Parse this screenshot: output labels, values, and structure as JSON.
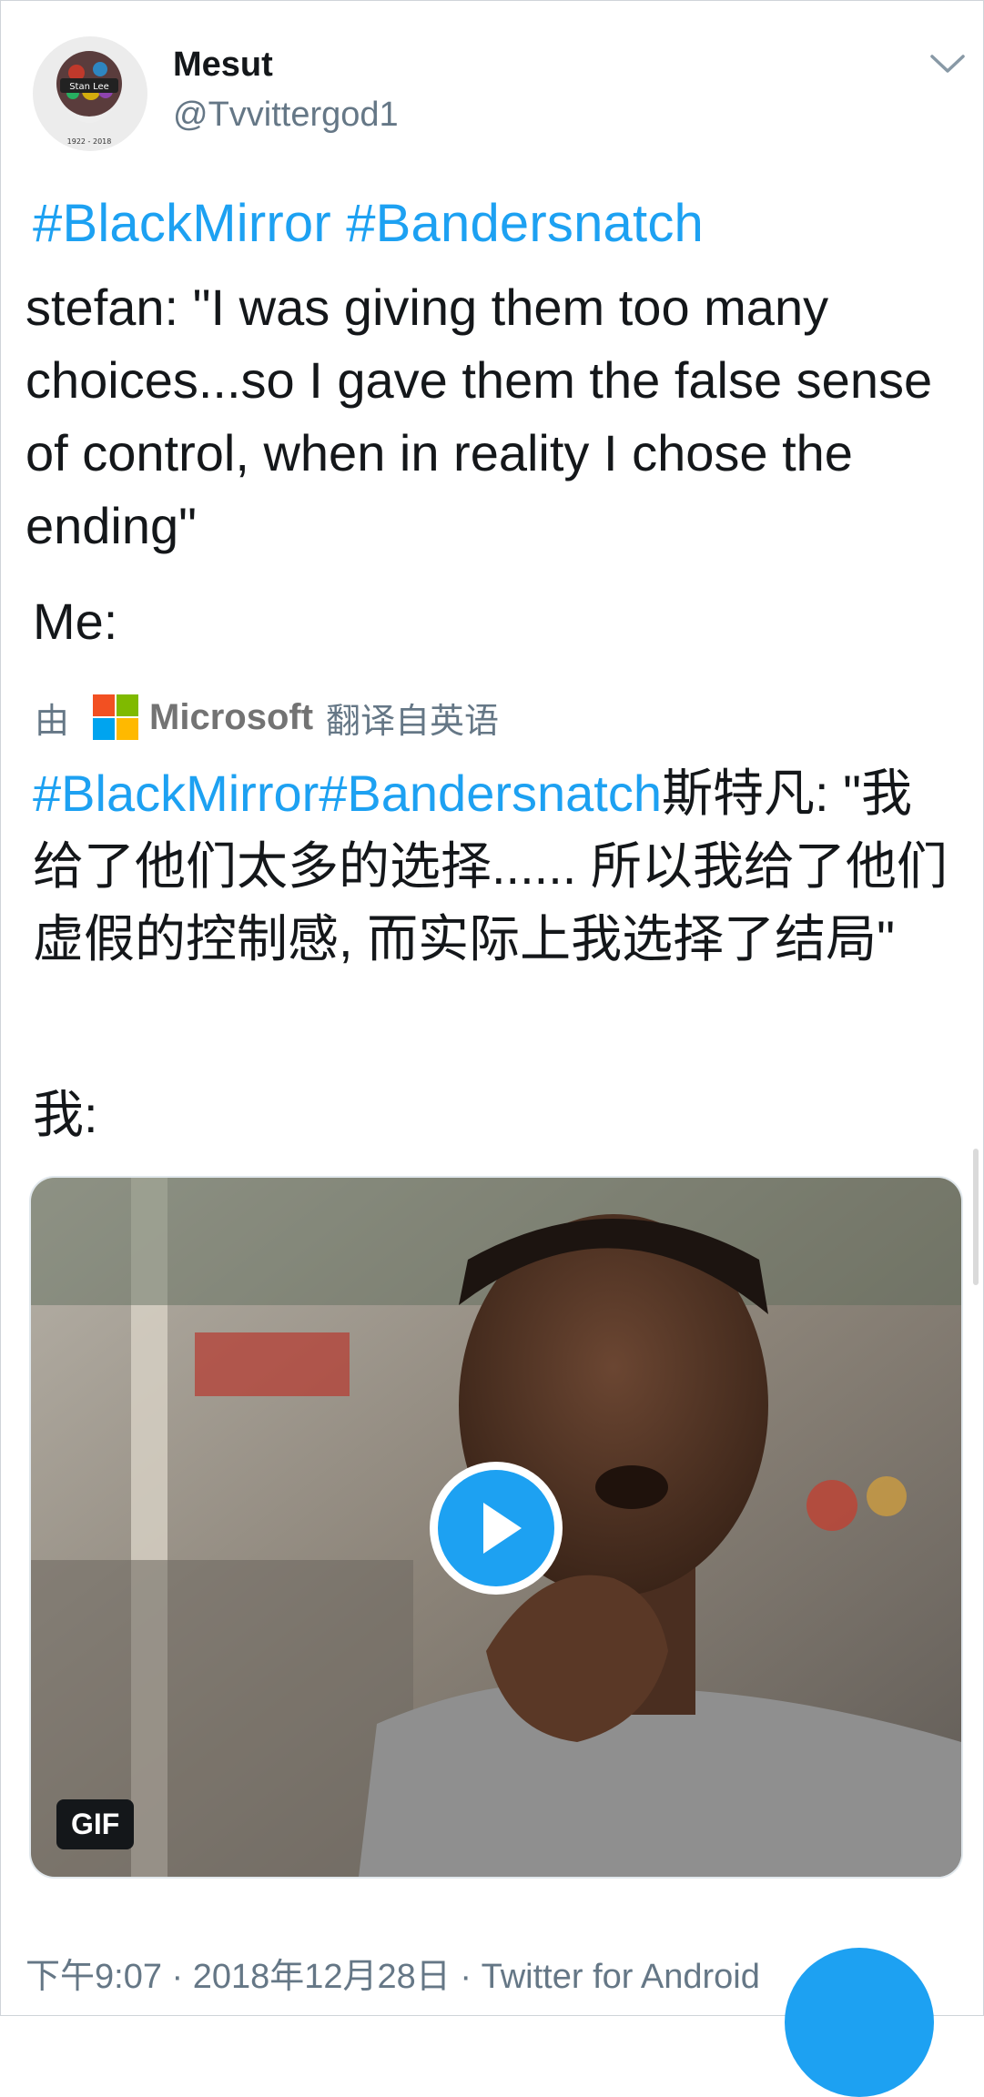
{
  "author": {
    "display_name": "Mesut",
    "handle": "@Tvvittergod1",
    "avatar_text": "Stan Lee",
    "avatar_years": "1922 - 2018"
  },
  "tweet": {
    "hashtags": [
      "#BlackMirror",
      "#Bandersnatch"
    ],
    "body": "stefan: \"I was giving them too many choices...so I gave them the false sense of control, when in reality I chose the ending\"",
    "me": "Me:"
  },
  "translation": {
    "by_label": "由",
    "provider": "Microsoft",
    "from_label": "翻译自英语",
    "hashtags": "#BlackMirror#Bandersnatch",
    "text": "斯特凡: \"我给了他们太多的选择...... 所以我给了他们虚假的控制感, 而实际上我选择了结局\"",
    "me": "我:"
  },
  "media": {
    "badge": "GIF",
    "play_icon": "play-icon"
  },
  "meta": {
    "time": "下午9:07",
    "date": "2018年12月28日",
    "source": "Twitter for Android"
  },
  "colors": {
    "accent": "#1da1f2",
    "secondary_text": "#657786",
    "ms_red": "#f25022",
    "ms_green": "#7fba00",
    "ms_blue": "#00a4ef",
    "ms_yellow": "#ffb900"
  }
}
